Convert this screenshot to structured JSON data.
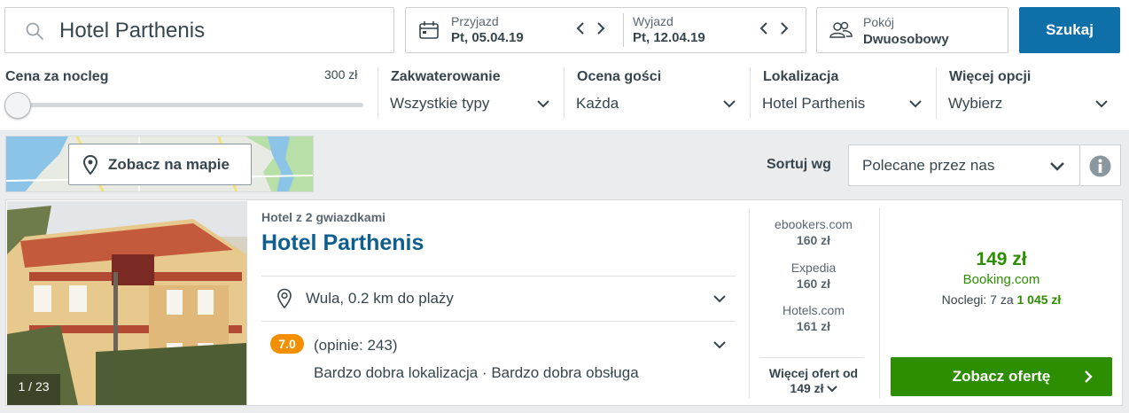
{
  "search": {
    "query": "Hotel Parthenis",
    "button_label": "Szukaj"
  },
  "dates": {
    "checkin_label": "Przyjazd",
    "checkin_value": "Pt, 05.04.19",
    "checkout_label": "Wyjazd",
    "checkout_value": "Pt, 12.04.19"
  },
  "rooms": {
    "label": "Pokój",
    "value": "Dwuosobowy"
  },
  "filters": {
    "price": {
      "label": "Cena za nocleg",
      "max_label": "300 zł",
      "slider_level": 0.0
    },
    "accommodation": {
      "label": "Zakwaterowanie",
      "value": "Wszystkie typy"
    },
    "rating": {
      "label": "Ocena gości",
      "value": "Każda"
    },
    "location": {
      "label": "Lokalizacja",
      "value": "Hotel Parthenis"
    },
    "more": {
      "label": "Więcej opcji",
      "value": "Wybierz"
    }
  },
  "map": {
    "button_label": "Zobacz na mapie"
  },
  "sort": {
    "label": "Sortuj wg",
    "value": "Polecane przez nas"
  },
  "result": {
    "photo_counter": "1 / 23",
    "stars_text": "Hotel z 2 gwiazdkami",
    "name": "Hotel Parthenis",
    "location_text": "Wula, 0.2 km do plaży",
    "rating_score": "7.0",
    "reviews_text": "(opinie: 243)",
    "highlights": "Bardzo dobra lokalizacja · Bardzo dobra obsługa",
    "partners": [
      {
        "name": "ebookers.com",
        "price": "160 zł"
      },
      {
        "name": "Expedia",
        "price": "160 zł"
      },
      {
        "name": "Hotels.com",
        "price": "161 zł"
      }
    ],
    "more_offers_label": "Więcej ofert od",
    "more_offers_price": "149 zł",
    "best_price": "149 zł",
    "best_site": "Booking.com",
    "nights_text": "Noclegi: 7 za",
    "total_price": "1 045 zł",
    "deal_button": "Zobacz ofertę"
  },
  "colors": {
    "primary_blue": "#0f6fa9",
    "deal_green": "#2c8e00",
    "rating_orange": "#f48f00",
    "title_blue": "#0e5e8e"
  }
}
